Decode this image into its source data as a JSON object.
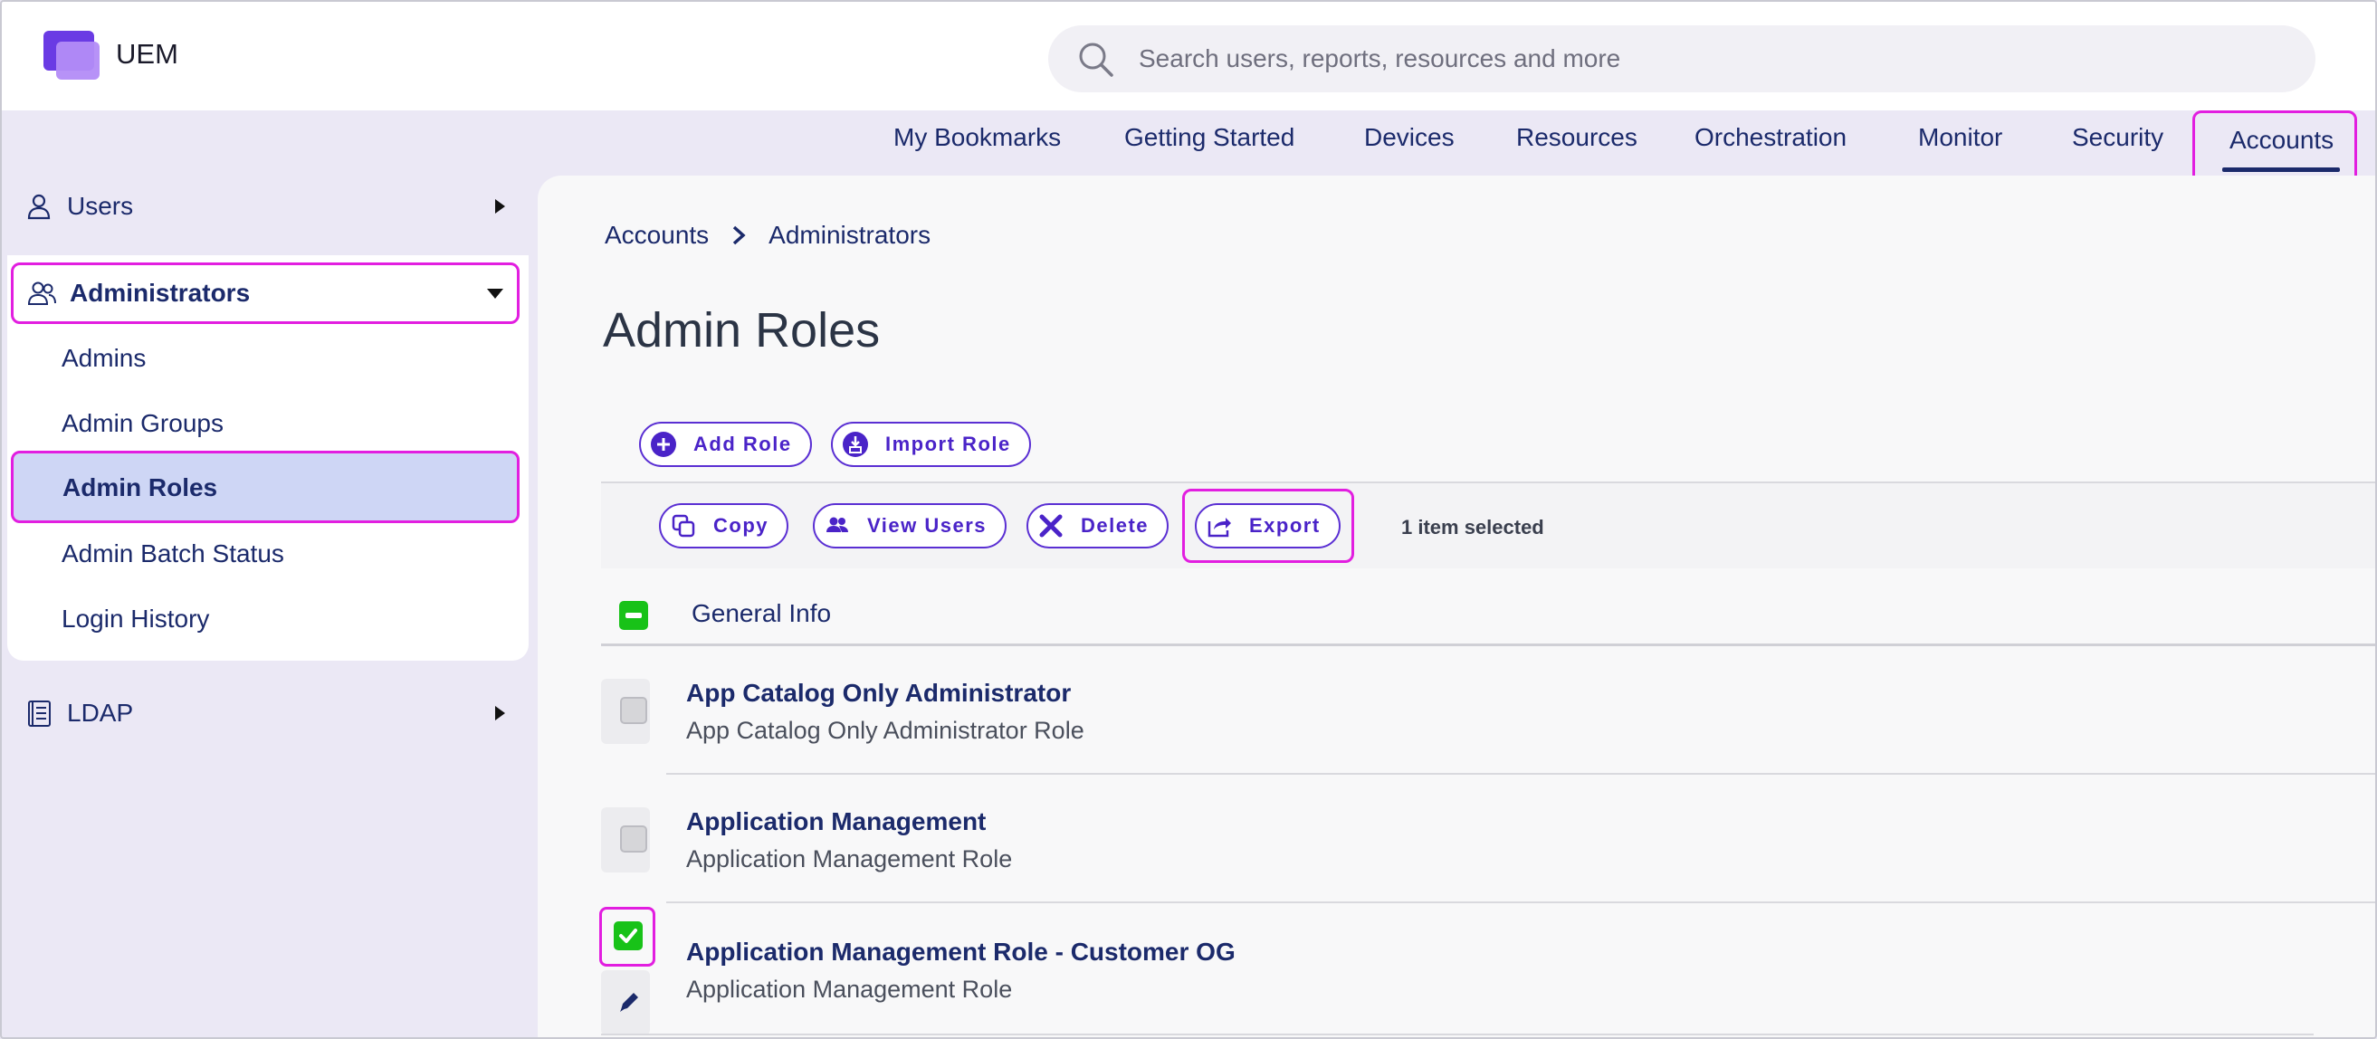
{
  "app": {
    "name": "UEM"
  },
  "search": {
    "placeholder": "Search users, reports, resources and more"
  },
  "topnav": {
    "items": [
      "My Bookmarks",
      "Getting Started",
      "Devices",
      "Resources",
      "Orchestration",
      "Monitor",
      "Security"
    ],
    "active": "Accounts"
  },
  "sidebar": {
    "users": "Users",
    "administrators": "Administrators",
    "sub_items": [
      "Admins",
      "Admin Groups",
      "Admin Roles",
      "Admin Batch Status",
      "Login History"
    ],
    "active_sub": "Admin Roles",
    "ldap": "LDAP"
  },
  "breadcrumb": {
    "root": "Accounts",
    "current": "Administrators"
  },
  "page": {
    "title": "Admin Roles"
  },
  "toolbar": {
    "add_role": "Add Role",
    "import_role": "Import Role",
    "copy": "Copy",
    "view_users": "View Users",
    "delete": "Delete",
    "export": "Export",
    "selection_count": "1 item selected"
  },
  "table": {
    "header": "General Info",
    "rows": [
      {
        "title": "App Catalog Only Administrator",
        "subtitle": "App Catalog Only Administrator Role",
        "checked": false
      },
      {
        "title": "Application Management",
        "subtitle": "Application Management Role",
        "checked": false
      },
      {
        "title": "Application Management Role - Customer OG",
        "subtitle": "Application Management Role",
        "checked": true
      }
    ]
  },
  "colors": {
    "accent": "#5a2fd3",
    "highlight": "#e21ee0",
    "nav_text": "#1b2a6b",
    "checkbox_on": "#18c218",
    "sidebar_bg": "#ebe8f5",
    "active_item_bg": "#ced6f5"
  },
  "icons": [
    "uem-logo",
    "search-icon",
    "user-icon",
    "users-group-icon",
    "ldap-book-icon",
    "caret-right-icon",
    "caret-down-icon",
    "chevron-right-icon",
    "plus-circle-icon",
    "import-icon",
    "copy-icon",
    "view-users-icon",
    "delete-x-icon",
    "export-share-icon",
    "pencil-icon"
  ]
}
